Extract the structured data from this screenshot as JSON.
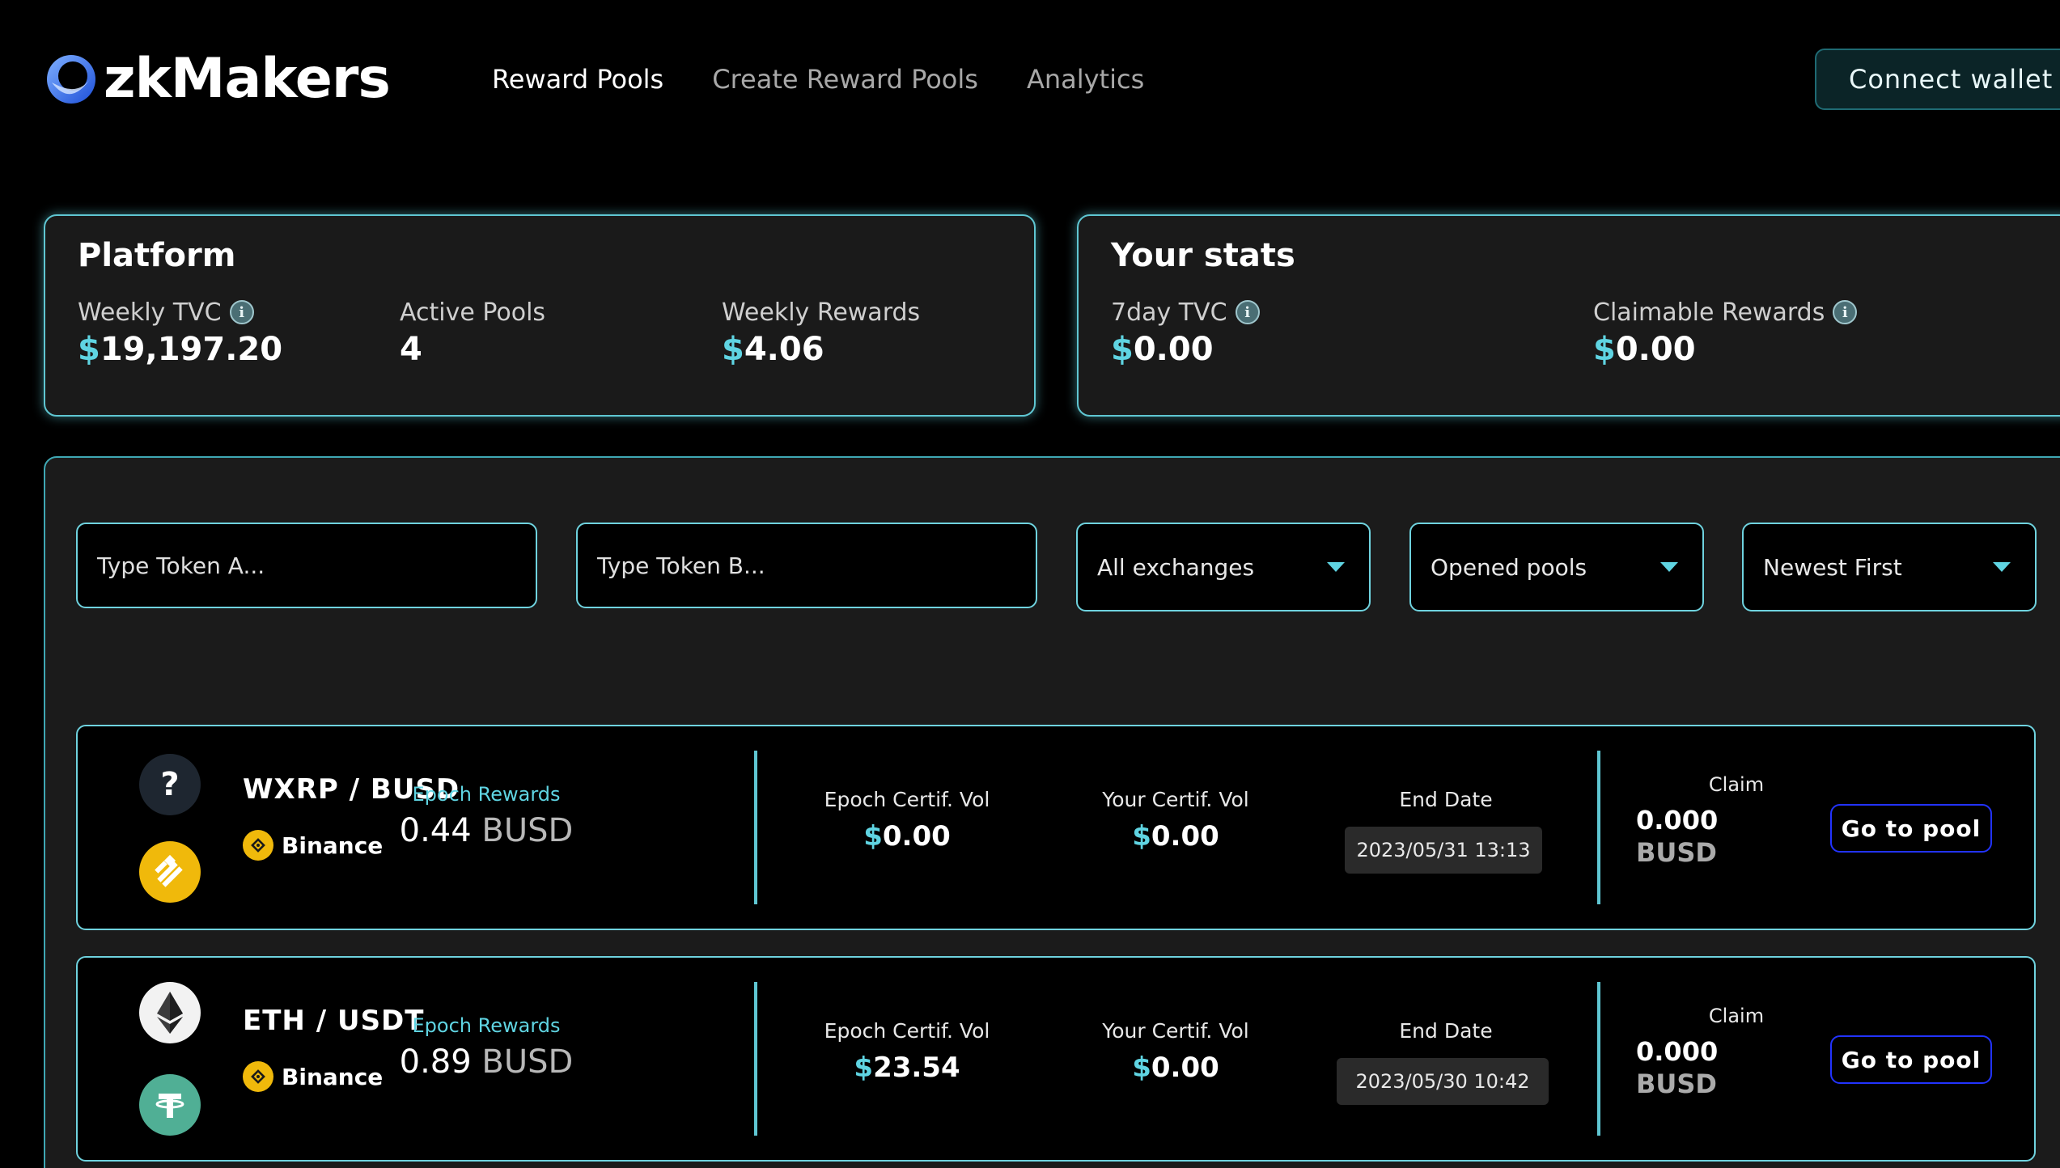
{
  "header": {
    "logo_text": "zkMakers",
    "nav": [
      {
        "label": "Reward Pools",
        "active": true
      },
      {
        "label": "Create Reward Pools",
        "active": false
      },
      {
        "label": "Analytics",
        "active": false
      }
    ],
    "connect_label": "Connect wallet"
  },
  "platform": {
    "title": "Platform",
    "weekly_tvc_label": "Weekly TVC",
    "weekly_tvc_value": "19,197.20",
    "active_pools_label": "Active Pools",
    "active_pools_value": "4",
    "weekly_rewards_label": "Weekly Rewards",
    "weekly_rewards_value": "4.06"
  },
  "your_stats": {
    "title": "Your stats",
    "tvc_label": "7day TVC",
    "tvc_value": "0.00",
    "claimable_label": "Claimable Rewards",
    "claimable_value": "0.00"
  },
  "filters": {
    "token_a_placeholder": "Type Token A...",
    "token_b_placeholder": "Type Token B...",
    "exchange_selected": "All exchanges",
    "status_selected": "Opened pools",
    "sort_selected": "Newest First"
  },
  "pools": [
    {
      "pair": "WXRP / BUSD",
      "token_a_icon": "unknown-token-icon",
      "token_b_icon": "busd-icon",
      "exchange": "Binance",
      "epoch_rewards_label": "Epoch Rewards",
      "epoch_rewards_amount": "0.44",
      "epoch_rewards_unit": "BUSD",
      "epoch_vol_label": "Epoch Certif. Vol",
      "epoch_vol_value": "0.00",
      "your_vol_label": "Your Certif. Vol",
      "your_vol_value": "0.00",
      "end_date_label": "End Date",
      "end_date": "2023/05/31 13:13",
      "claim_label": "Claim",
      "claim_amount": "0.000",
      "claim_unit": "BUSD",
      "goto_label": "Go to pool"
    },
    {
      "pair": "ETH / USDT",
      "token_a_icon": "eth-icon",
      "token_b_icon": "tether-icon",
      "exchange": "Binance",
      "epoch_rewards_label": "Epoch Rewards",
      "epoch_rewards_amount": "0.89",
      "epoch_rewards_unit": "BUSD",
      "epoch_vol_label": "Epoch Certif. Vol",
      "epoch_vol_value": "23.54",
      "your_vol_label": "Your Certif. Vol",
      "your_vol_value": "0.00",
      "end_date_label": "End Date",
      "end_date": "2023/05/30 10:42",
      "claim_label": "Claim",
      "claim_amount": "0.000",
      "claim_unit": "BUSD",
      "goto_label": "Go to pool"
    }
  ],
  "colors": {
    "accent": "#5fd4e2",
    "border": "#6fd3df",
    "button_border": "#2233ff",
    "binance": "#f0b90b",
    "tether": "#50af95"
  }
}
